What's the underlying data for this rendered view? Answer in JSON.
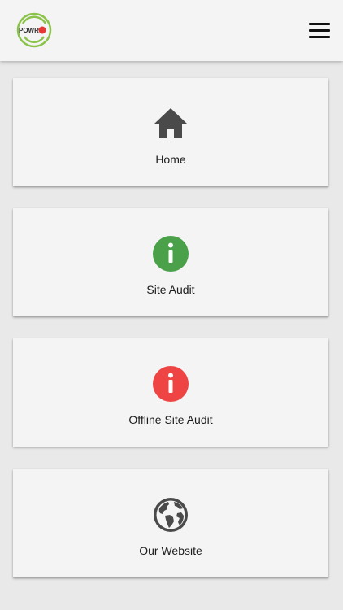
{
  "header": {
    "logo_text": "POWR",
    "menu_icon": "hamburger-menu-icon"
  },
  "menu": [
    {
      "label": "Home",
      "icon": "home-icon"
    },
    {
      "label": "Site Audit",
      "icon": "info-icon",
      "color": "#4aa14a"
    },
    {
      "label": "Offline Site Audit",
      "icon": "info-icon",
      "color": "#ef4444"
    },
    {
      "label": "Our Website",
      "icon": "globe-icon"
    }
  ],
  "colors": {
    "background": "#e9e9e9",
    "card": "#f4f4f4",
    "icon_dark": "#4a4a4a",
    "logo_green": "#8bc34a",
    "logo_red": "#e53935"
  }
}
